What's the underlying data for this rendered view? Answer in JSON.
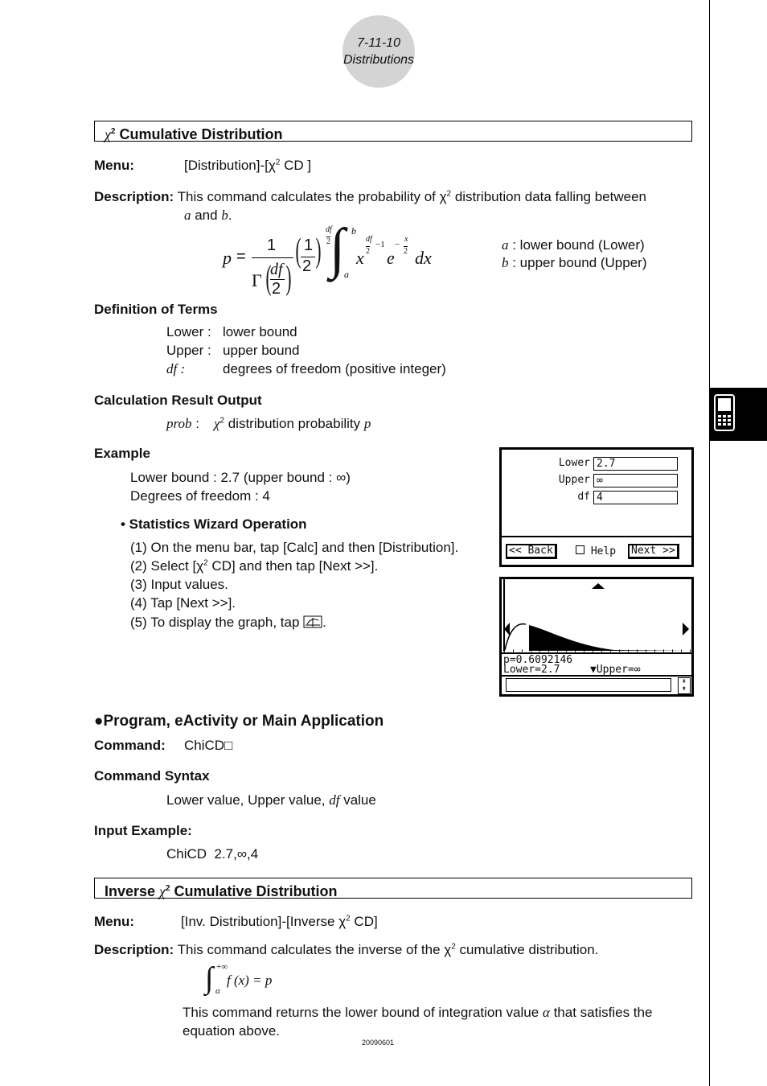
{
  "header": {
    "section": "7-11-10",
    "chapter": "Distributions"
  },
  "s1": {
    "title_chi": "χ",
    "title_sup": "2",
    "title": " Cumulative Distribution"
  },
  "menu": {
    "label": "Menu:",
    "text_a": "[Distribution]-[χ",
    "sup": "2",
    "text_b": " CD ]"
  },
  "desc": {
    "label": "Description:",
    "text_a": "This command calculates the probability of χ",
    "sup": "2",
    "text_b": " distribution data falling between",
    "line2_a": "a",
    "line2_and": " and ",
    "line2_b": "b",
    "line2_end": "."
  },
  "formula": {
    "p": "p",
    "eq": "=",
    "one": "1",
    "gamma": "Γ",
    "df": "df",
    "two": "2",
    "half_num": "1",
    "half_den": "2",
    "exp_df": "df",
    "exp_two": "2",
    "int_upper": "b",
    "int_lower": "a",
    "x": "x",
    "xexp_df": "df",
    "xexp_two": "2",
    "xexp_minus1": "−1",
    "e": "e",
    "eexp_minus": "−",
    "eexp_x": "x",
    "eexp_two": "2",
    "dx": "dx"
  },
  "bounds": [
    {
      "sym": "a",
      "text": " : lower bound (Lower)"
    },
    {
      "sym": "b",
      "text": " : upper bound (Upper)"
    }
  ],
  "terms": {
    "heading": "Definition of Terms",
    "items": [
      {
        "term": "Lower :",
        "def": "lower bound"
      },
      {
        "term": "Upper :",
        "def": "upper bound"
      },
      {
        "term": "df :",
        "def": "degrees of freedom (positive integer)"
      }
    ]
  },
  "output": {
    "heading": "Calculation Result Output",
    "term": "prob",
    "colon": " :",
    "chi": "χ",
    "sup": "2",
    "text": " distribution probability ",
    "p": "p"
  },
  "example": {
    "heading": "Example",
    "line1": "Lower bound : 2.7 (upper bound : ∞)",
    "line2": "Degrees of freedom : 4",
    "wizard": "• Statistics Wizard Operation",
    "steps": [
      "(1) On the menu bar, tap [Calc] and then [Distribution].",
      "(2) Select [χ",
      "(3) Input values.",
      "(4) Tap [Next >>].",
      "(5) To display the graph, tap "
    ],
    "step2_sup": "2",
    "step2_end": " CD] and then tap [Next >>].",
    "step5_end": "."
  },
  "wizard_screen": {
    "fields": [
      {
        "label": "Lower",
        "value": "2.7"
      },
      {
        "label": "Upper",
        "value": "∞"
      },
      {
        "label": "df",
        "value": "4"
      }
    ],
    "back": "<< Back",
    "help": "Help",
    "next": "Next >>"
  },
  "graph_screen": {
    "p": "p=0.6092146",
    "lower": "Lower=2.7",
    "upper": "▼Upper=∞",
    "fill_color": "#000000"
  },
  "program": {
    "heading": "●Program, eActivity or Main Application",
    "cmd_label": "Command:",
    "cmd": "ChiCD□",
    "syntax_heading": "Command Syntax",
    "syntax_a": "Lower value, Upper value, ",
    "syntax_df": "df",
    "syntax_b": " value",
    "input_heading": "Input Example:",
    "input": "ChiCD  2.7,∞,4"
  },
  "s2": {
    "title_a": "Inverse ",
    "title_chi": "χ",
    "title_sup": "2",
    "title_b": " Cumulative Distribution"
  },
  "menu2": {
    "label": "Menu:",
    "text_a": "[Inv. Distribution]-[Inverse χ",
    "sup": "2",
    "text_b": " CD]"
  },
  "desc2": {
    "label": "Description:",
    "text_a": "This command calculates the inverse of the χ",
    "sup": "2",
    "text_b": " cumulative distribution.",
    "eq_upper": "+∞",
    "eq_lower": "α",
    "eq_body": "f (x) = p",
    "para1_a": "This command returns the lower bound of integration value ",
    "alpha": "α",
    "para1_b": " that satisfies the",
    "para2": "equation above."
  },
  "footer": {
    "code": "20090601"
  },
  "side_tab": {
    "icon": "calculator-icon"
  }
}
